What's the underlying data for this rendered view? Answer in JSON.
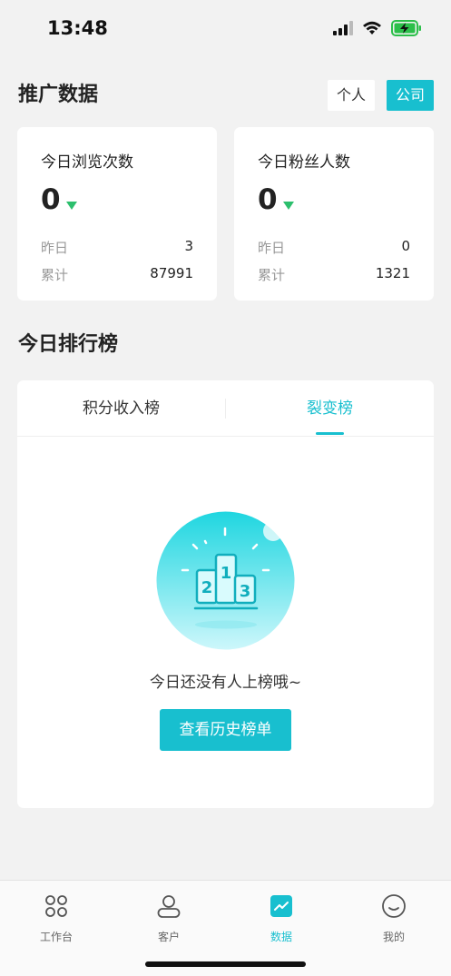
{
  "status": {
    "time": "13:48"
  },
  "promo": {
    "title": "推广数据",
    "segments": [
      {
        "label": "个人",
        "active": false
      },
      {
        "label": "公司",
        "active": true
      }
    ]
  },
  "stats": [
    {
      "title": "今日浏览次数",
      "value": "0",
      "trend": "down",
      "yesterday_label": "昨日",
      "yesterday": "3",
      "total_label": "累计",
      "total": "87991"
    },
    {
      "title": "今日粉丝人数",
      "value": "0",
      "trend": "down",
      "yesterday_label": "昨日",
      "yesterday": "0",
      "total_label": "累计",
      "total": "1321"
    }
  ],
  "ranking": {
    "title": "今日排行榜",
    "tabs": [
      {
        "label": "积分收入榜",
        "active": false
      },
      {
        "label": "裂变榜",
        "active": true
      }
    ],
    "empty_text": "今日还没有人上榜哦~",
    "history_button": "查看历史榜单",
    "podium_numbers": [
      "2",
      "1",
      "3"
    ]
  },
  "nav": [
    {
      "label": "工作台",
      "icon": "grid-icon",
      "active": false
    },
    {
      "label": "客户",
      "icon": "user-icon",
      "active": false
    },
    {
      "label": "数据",
      "icon": "chart-icon",
      "active": true
    },
    {
      "label": "我的",
      "icon": "smile-icon",
      "active": false
    }
  ],
  "colors": {
    "accent": "#18bfcf",
    "down": "#2cbf6d",
    "background": "#f2f2f2"
  }
}
